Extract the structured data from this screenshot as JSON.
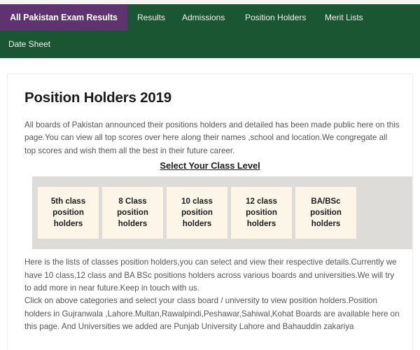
{
  "nav": {
    "brand": "All Pakistan Exam Results",
    "links_row1": [
      "Results",
      "Admissions",
      "Position Holders",
      "Merit Lists"
    ],
    "links_row2": [
      "Date Sheet"
    ],
    "brand_bg": "#5f3370",
    "bar_bg": "#1b5632"
  },
  "main": {
    "title": "Position Holders 2019",
    "intro": "All boards of Pakistan announced their positions holders and detailed has been made public here on this page.You can view all top scores over here along their names ,school and location.We congregate all top scores and wish them all the best in their future career.",
    "section_heading": "Select Your Class Level",
    "levels": [
      {
        "line1": "5th class",
        "line2": "position",
        "line3": "holders"
      },
      {
        "line1": "8 Class",
        "line2": "position",
        "line3": "holders"
      },
      {
        "line1": "10 class",
        "line2": "position",
        "line3": "holders"
      },
      {
        "line1": "12 class",
        "line2": "position",
        "line3": "holders"
      },
      {
        "line1": "BA/BSc",
        "line2": "position",
        "line3": "holders"
      }
    ],
    "body_paragraph_1": "Here is the lists of classes position holders,you can select and view their respective details.Currently we have 10 class,12 class and BA BSc positions holders across various boards and universities.We will try to add more in near future.Keep in touch with us.",
    "body_paragraph_2": "Click on above categories and select your class board / university to view position holders.Position holders in Gujranwala ,Lahore.Multan,Rawalpindi,Peshawar,Sahiwal,Kohat Boards are available here on this page. And Universities we added are Punjab University Lahore and Bahauddin zakariya",
    "card_bg": "#fcf5e8",
    "band_bg": "#dedcd8"
  }
}
